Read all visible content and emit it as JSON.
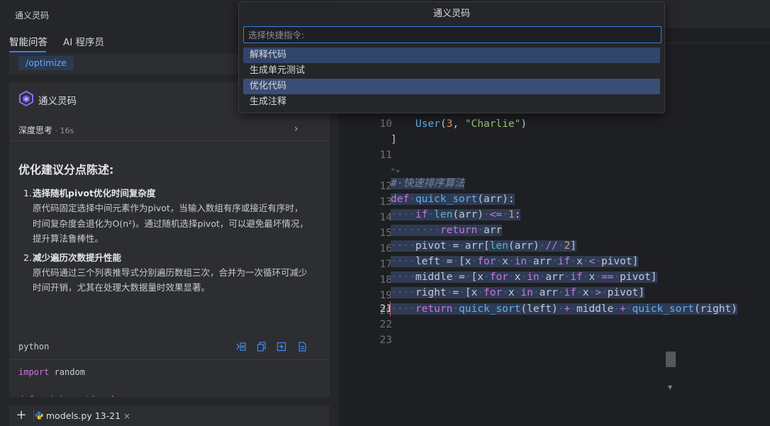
{
  "left_panel": {
    "title": "通义灵码",
    "tabs": [
      {
        "label": "智能问答",
        "active": true
      },
      {
        "label": "AI 程序员",
        "active": false
      }
    ],
    "command_chip": "/optimize",
    "answer": {
      "bot_name": "通义灵码",
      "thinking_label": "深度思考",
      "thinking_time": " · 16s",
      "heading": "优化建议分点陈述:",
      "points": [
        {
          "number": "1.",
          "title": "选择随机pivot优化时间复杂度",
          "body": "原代码固定选择中间元素作为pivot，当输入数组有序或接近有序时，时间复杂度会退化为O(n²)。通过随机选择pivot，可以避免最坏情况，提升算法鲁棒性。"
        },
        {
          "number": "2.",
          "title": "减少遍历次数提升性能",
          "body": "原代码通过三个列表推导式分别遍历数组三次，合并为一次循环可减少时间开销，尤其在处理大数据量时效果显著。"
        }
      ],
      "code_block": {
        "language": "python",
        "tools": [
          "insert-icon",
          "copy-icon",
          "new-file-icon",
          "diff-icon"
        ]
      }
    },
    "input_bar": {
      "add_label": "+",
      "file_chip": "models.py 13-21",
      "close": "×"
    }
  },
  "editor": {
    "line_numbers": [
      "10",
      "11",
      "12",
      "13",
      "14",
      "15",
      "16",
      "17",
      "18",
      "19",
      "20",
      "21",
      "22",
      "23"
    ],
    "active_line": "21"
  },
  "palette": {
    "title": "通义灵码",
    "placeholder": "选择快捷指令:",
    "items": [
      "解释代码",
      "生成单元测试",
      "优化代码",
      "生成注释"
    ],
    "selected": "优化代码"
  },
  "colors": {
    "accent": "#3d7df3",
    "selection": "#2f3b54",
    "palette_selected": "#3a4e75"
  }
}
